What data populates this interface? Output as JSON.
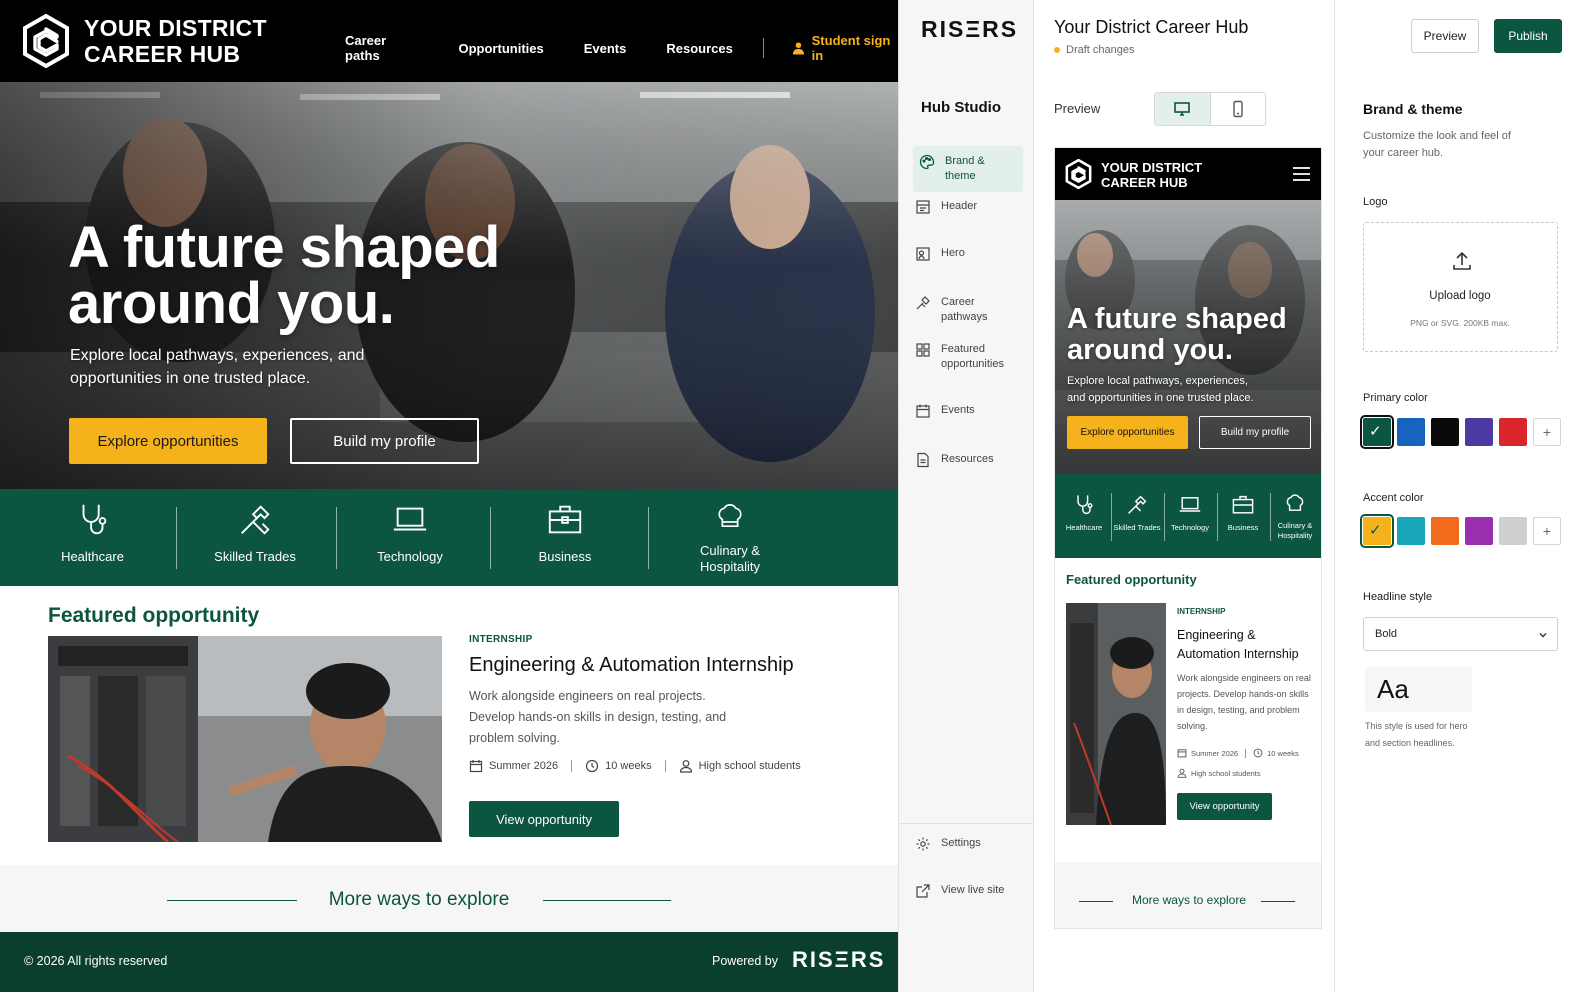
{
  "site": {
    "logo_line1": "YOUR DISTRICT",
    "logo_line2": "CAREER HUB",
    "nav": [
      "Career paths",
      "Opportunities",
      "Events",
      "Resources"
    ],
    "sign_in": "Student sign in",
    "hero_title": "A future shaped\naround you.",
    "hero_sub": "Explore local pathways, experiences, and opportunities in one trusted place.",
    "btn_explore": "Explore opportunities",
    "btn_profile": "Build my profile",
    "pathways": [
      "Healthcare",
      "Skilled Trades",
      "Technology",
      "Business",
      "Culinary & Hospitality"
    ],
    "featured_title": "Featured opportunity",
    "feat_tag": "INTERNSHIP",
    "feat_heading": "Engineering & Automation Internship",
    "feat_desc": "Work alongside engineers on real projects. Develop hands-on skills in design, testing, and problem solving.",
    "feat_term": "Summer 2026",
    "feat_duration": "10 weeks",
    "feat_audience": "High school students",
    "btn_view": "View opportunity",
    "more_ways": "More ways to explore",
    "copyright": "© 2026 All rights reserved",
    "powered_by": "Powered by",
    "powered_brand": "RISΞRS"
  },
  "studio": {
    "brand": "RISΞRS",
    "title": "Hub Studio",
    "nav": [
      {
        "label": "Brand & theme",
        "icon": "palette-icon",
        "active": true
      },
      {
        "label": "Header",
        "icon": "header-icon"
      },
      {
        "label": "Hero",
        "icon": "hero-image-icon"
      },
      {
        "label": "Career pathways",
        "icon": "pathways-icon"
      },
      {
        "label": "Featured opportunities",
        "icon": "grid-icon"
      },
      {
        "label": "Events",
        "icon": "calendar-icon"
      },
      {
        "label": "Resources",
        "icon": "document-icon"
      }
    ],
    "settings_label": "Settings",
    "view_live_label": "View live site"
  },
  "editor": {
    "hub_title": "Your District Career Hub",
    "status": "Draft changes",
    "preview_label": "Preview",
    "preview_mode": "desktop"
  },
  "mobile_preview": {
    "logo_line1": "YOUR DISTRICT",
    "logo_line2": "CAREER HUB",
    "hero_title": "A future shaped\naround you.",
    "hero_sub": "Explore local pathways, experiences, and opportunities in one trusted place.",
    "btn_explore": "Explore opportunities",
    "btn_profile": "Build my profile",
    "pathways": [
      "Healthcare",
      "Skilled Trades",
      "Technology",
      "Business",
      "Culinary & Hospitality"
    ],
    "featured_title": "Featured opportunity",
    "feat_tag": "INTERNSHIP",
    "feat_heading": "Engineering & Automation Internship",
    "feat_desc": "Work alongside engineers on real projects. Develop hands-on skills in design, testing, and problem solving.",
    "feat_term": "Summer 2026",
    "feat_duration": "10 weeks",
    "feat_audience": "High school students",
    "btn_view": "View opportunity",
    "more_ways": "More ways to explore"
  },
  "settings": {
    "btn_preview": "Preview",
    "btn_publish": "Publish",
    "title": "Brand & theme",
    "desc": "Customize the look and feel of your career hub.",
    "logo_label": "Logo",
    "upload_label": "Upload logo",
    "upload_hint": "PNG or SVG. 200KB max.",
    "primary_label": "Primary color",
    "primary_colors": [
      "#0c5540",
      "#1565c0",
      "#0a0a0a",
      "#4b3aa3",
      "#d8262c"
    ],
    "primary_selected": 0,
    "accent_label": "Accent color",
    "accent_colors": [
      "#f5b21b",
      "#18a6b8",
      "#f26a1b",
      "#9a2fb0",
      "#cfcfcf"
    ],
    "accent_selected": 0,
    "headline_label": "Headline style",
    "headline_value": "Bold",
    "sample": "Aa",
    "sample_note": "This style is used for hero and section headlines."
  }
}
